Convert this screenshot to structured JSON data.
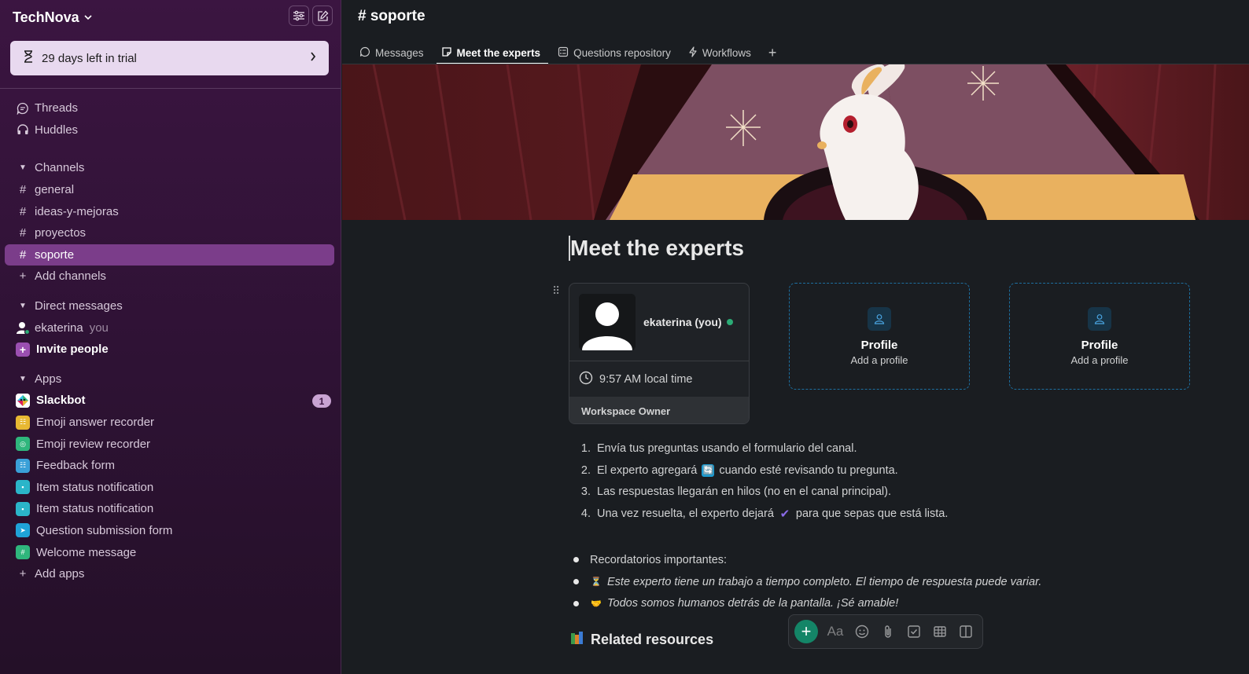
{
  "workspace": {
    "name": "TechNova"
  },
  "trial": {
    "label": "29 days left in trial"
  },
  "sidebar": {
    "top_items": [
      {
        "label": "Threads",
        "icon": "threads-icon"
      },
      {
        "label": "Huddles",
        "icon": "headphones-icon"
      }
    ],
    "channels_header": "Channels",
    "channels": [
      "general",
      "ideas-y-mejoras",
      "proyectos",
      "soporte"
    ],
    "active_channel": "soporte",
    "add_channels": "Add channels",
    "dm_header": "Direct messages",
    "dm_user": "ekaterina",
    "dm_you": "you",
    "invite": "Invite people",
    "apps_header": "Apps",
    "apps": [
      {
        "label": "Slackbot",
        "badge": "1",
        "color": "#1b9ad6"
      },
      {
        "label": "Emoji answer recorder",
        "color": "#e8b832"
      },
      {
        "label": "Emoji review recorder",
        "color": "#2fb67c"
      },
      {
        "label": "Feedback form",
        "color": "#3aa0d8"
      },
      {
        "label": "Item status notification",
        "color": "#2bb5c9"
      },
      {
        "label": "Item status notification",
        "color": "#2bb5c9"
      },
      {
        "label": "Question submission form",
        "color": "#1fa3d8"
      },
      {
        "label": "Welcome message",
        "color": "#2fb67c"
      }
    ],
    "add_apps": "Add apps"
  },
  "channel": {
    "title": "soporte"
  },
  "tabs": [
    {
      "label": "Messages",
      "icon": "message-icon"
    },
    {
      "label": "Meet the experts",
      "icon": "canvas-icon",
      "active": true
    },
    {
      "label": "Questions repository",
      "icon": "list-icon"
    },
    {
      "label": "Workflows",
      "icon": "workflow-icon"
    }
  ],
  "doc": {
    "title": "Meet the experts",
    "profile": {
      "name": "ekaterina (you)",
      "time": "9:57 AM local time",
      "role": "Workspace Owner"
    },
    "empty_profile": {
      "title": "Profile",
      "subtitle": "Add a profile"
    },
    "steps": [
      {
        "pre": "Envía tus preguntas usando el formulario del canal.",
        "post": ""
      },
      {
        "pre": "El experto agregará",
        "post": "cuando esté revisando tu pregunta."
      },
      {
        "pre": "Las respuestas llegarán en hilos (no en el canal principal).",
        "post": ""
      },
      {
        "pre": "Una vez resuelta, el experto dejará",
        "post": "para que sepas que está lista."
      }
    ],
    "reminders": [
      "Recordatorios importantes:",
      "Este experto tiene un trabajo a tiempo completo. El tiempo de respuesta puede variar.",
      "Todos somos humanos detrás de la pantalla. ¡Sé amable!"
    ],
    "related": "Related resources"
  },
  "toolbar": {
    "text_format": "Aa"
  }
}
